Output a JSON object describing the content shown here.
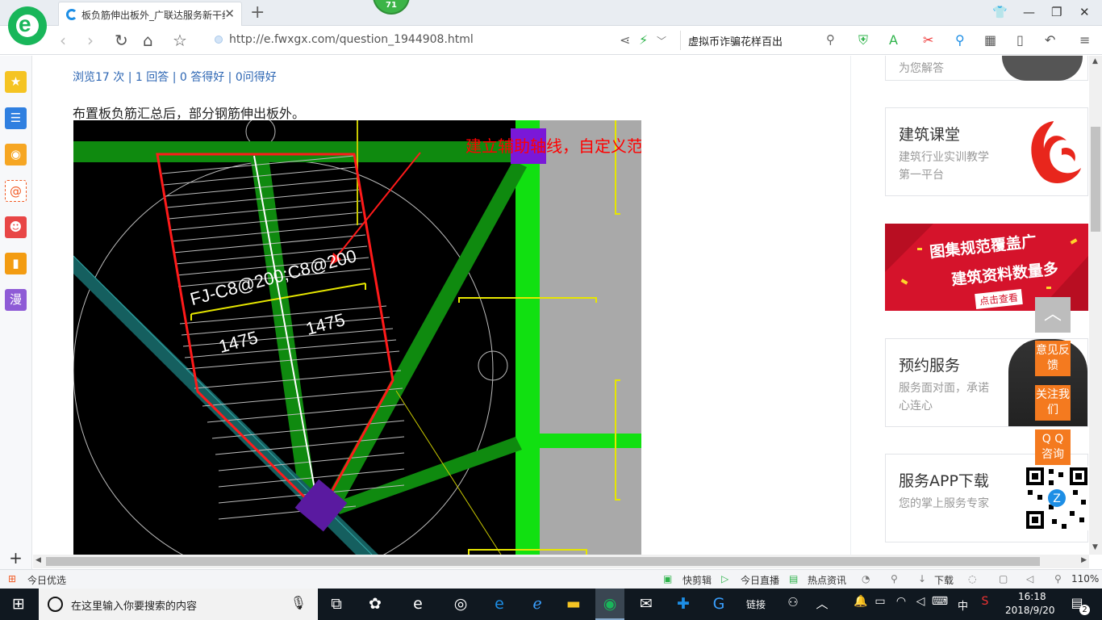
{
  "browser": {
    "tab_title": "板负筋伸出板外_广联达服务新干线",
    "badge_count": "71",
    "url": "http://e.fwxgx.com/question_1944908.html",
    "search_text": "虚拟币诈骗花样百出",
    "brand_colors": {
      "logo": "#19b65a",
      "accent": "#1d8ee5"
    }
  },
  "page": {
    "stats": "浏览17 次 | 1 回答 | 0 答得好 | 0问得好",
    "description": "布置板负筋汇总后，部分钢筋伸出板外。",
    "cad": {
      "annotation": "建立辅助轴线，自定义范围布置",
      "rebar_label": "FJ-C8@200;C8@200",
      "dim_left": "1475",
      "dim_right": "1475"
    }
  },
  "right_panel": {
    "top_card_text": "为您解答",
    "card_course_title": "建筑课堂",
    "card_course_sub": "建筑行业实训教学第一平台",
    "banner_line1": "图集规范覆盖广",
    "banner_line2": "建筑资料数量多",
    "banner_cta": "点击查看",
    "card_service_title": "预约服务",
    "card_service_sub": "服务面对面，承诺心连心",
    "card_app_title": "服务APP下载",
    "card_app_sub": "您的掌上服务专家",
    "float_feedback": "意见反馈",
    "float_follow": "关注我们",
    "float_qq": "Q Q 咨询",
    "float_top_icon": "chevron-up-icon"
  },
  "statusbar": {
    "left": "今日优选",
    "quick_clip": "快剪辑",
    "live": "今日直播",
    "news": "热点资讯",
    "download": "下载",
    "zoom": "110%"
  },
  "taskbar": {
    "search_placeholder": "在这里输入你要搜索的内容",
    "links_label": "链接",
    "ime": "中",
    "time": "16:18",
    "date": "2018/9/20",
    "notification_count": "2"
  }
}
